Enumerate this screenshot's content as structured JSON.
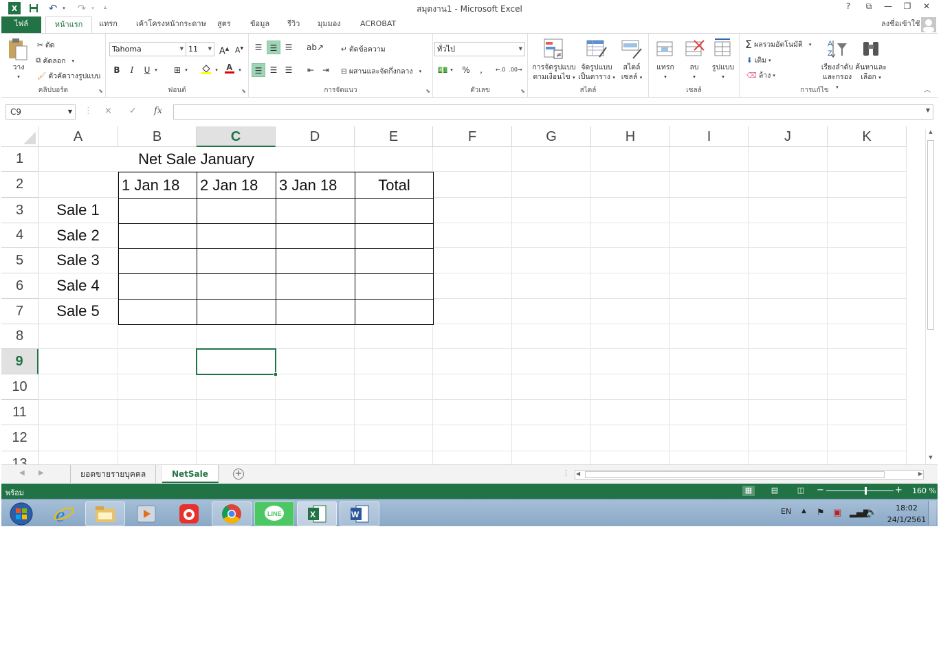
{
  "window": {
    "title": "สมุดงาน1 - Microsoft Excel",
    "help": "?",
    "account": "ลงชื่อเข้าใช้"
  },
  "ribbon_tabs": [
    "ไฟล์",
    "หน้าแรก",
    "แทรก",
    "เค้าโครงหน้ากระดาษ",
    "สูตร",
    "ข้อมูล",
    "รีวิว",
    "มุมมอง",
    "ACROBAT"
  ],
  "ribbon": {
    "clipboard": {
      "paste": "วาง",
      "cut": "ตัด",
      "copy": "คัดลอก",
      "format_painter": "ตัวคัดวางรูปแบบ",
      "label": "คลิปบอร์ด"
    },
    "font": {
      "name": "Tahoma",
      "size": "11",
      "bold": "B",
      "italic": "I",
      "underline": "U",
      "label": "ฟอนต์"
    },
    "alignment": {
      "wrap_text": "ตัดข้อความ",
      "merge_center": "ผสานและจัดกึ่งกลาง",
      "label": "การจัดแนว"
    },
    "number": {
      "format": "ทั่วไป",
      "percent": "%",
      "comma": ",",
      "label": "ตัวเลข"
    },
    "styles": {
      "conditional_line1": "การจัดรูปแบบ",
      "conditional_line2": "ตามเงื่อนไข",
      "table_line1": "จัดรูปแบบ",
      "table_line2": "เป็นตาราง",
      "cell_line1": "สไตล์",
      "cell_line2": "เซลล์",
      "label": "สไตล์"
    },
    "cells": {
      "insert": "แทรก",
      "delete": "ลบ",
      "format": "รูปแบบ",
      "label": "เซลล์"
    },
    "editing": {
      "autosum": "ผลรวมอัตโนมัติ",
      "fill": "เติม",
      "clear": "ล้าง",
      "sort_line1": "เรียงลำดับ",
      "sort_line2": "และกรอง",
      "find_line1": "ค้นหาและ",
      "find_line2": "เลือก",
      "label": "การแก้ไข"
    }
  },
  "formula_bar": {
    "name_box": "C9",
    "cancel": "×",
    "enter": "✓",
    "fx": "fx",
    "value": ""
  },
  "columns": [
    "A",
    "B",
    "C",
    "D",
    "E",
    "F",
    "G",
    "H",
    "I",
    "J",
    "K"
  ],
  "rows": [
    "1",
    "2",
    "3",
    "4",
    "5",
    "6",
    "7",
    "8",
    "9",
    "10",
    "11",
    "12",
    "13"
  ],
  "selected_cell": "C9",
  "sheet": {
    "title": "Net Sale January",
    "headers": [
      "",
      "1 Jan 18",
      "2 Jan 18",
      "3 Jan 18",
      "Total"
    ],
    "rows": [
      [
        "Sale 1",
        "",
        "",
        "",
        ""
      ],
      [
        "Sale 2",
        "",
        "",
        "",
        ""
      ],
      [
        "Sale 3",
        "",
        "",
        "",
        ""
      ],
      [
        "Sale 4",
        "",
        "",
        "",
        ""
      ],
      [
        "Sale 5",
        "",
        "",
        "",
        ""
      ]
    ]
  },
  "sheet_tabs": [
    "ยอดขายรายบุคคล",
    "NetSale"
  ],
  "active_sheet": "NetSale",
  "status": {
    "text": "พร้อม",
    "zoom": "160 %"
  },
  "taskbar": {
    "lang": "EN",
    "time": "18:02",
    "date": "24/1/2561",
    "apps": [
      "start",
      "internet-explorer",
      "file-explorer",
      "media-player",
      "camera-app",
      "chrome",
      "line",
      "excel",
      "word"
    ]
  },
  "colors": {
    "excel_green": "#217346",
    "selected_bg": "#9fd5b7"
  }
}
